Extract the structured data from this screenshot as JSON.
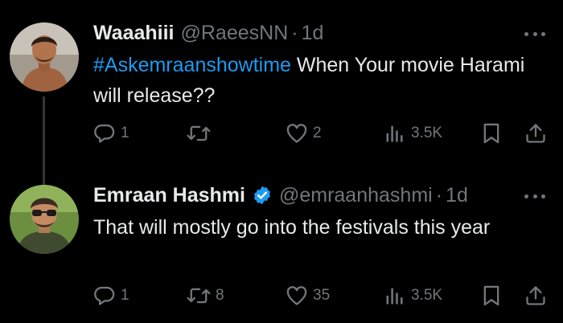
{
  "tweets": [
    {
      "name": "Waaahiii",
      "handle": "@RaeesNN",
      "separator": "·",
      "time": "1d",
      "hashtag": "#Askemraanshowtime",
      "text": " When Your movie Harami will release??",
      "verified": false,
      "stats": {
        "replies": "1",
        "retweets": "",
        "likes": "2",
        "views": "3.5K"
      }
    },
    {
      "name": "Emraan Hashmi",
      "handle": "@emraanhashmi",
      "separator": "·",
      "time": "1d",
      "hashtag": "",
      "text": "That will mostly go into the festivals this year",
      "verified": true,
      "stats": {
        "replies": "1",
        "retweets": "8",
        "likes": "35",
        "views": "3.5K"
      }
    }
  ],
  "colors": {
    "background": "#000000",
    "text": "#e7e9ea",
    "muted": "#71767b",
    "accent": "#1d9bf0",
    "thread_line": "#333639"
  },
  "icons": {
    "reply": "reply-icon",
    "retweet": "retweet-icon",
    "like": "heart-icon",
    "views": "views-chart-icon",
    "bookmark": "bookmark-icon",
    "share": "share-icon",
    "more": "more-dots-icon",
    "verified": "verified-badge-icon"
  }
}
